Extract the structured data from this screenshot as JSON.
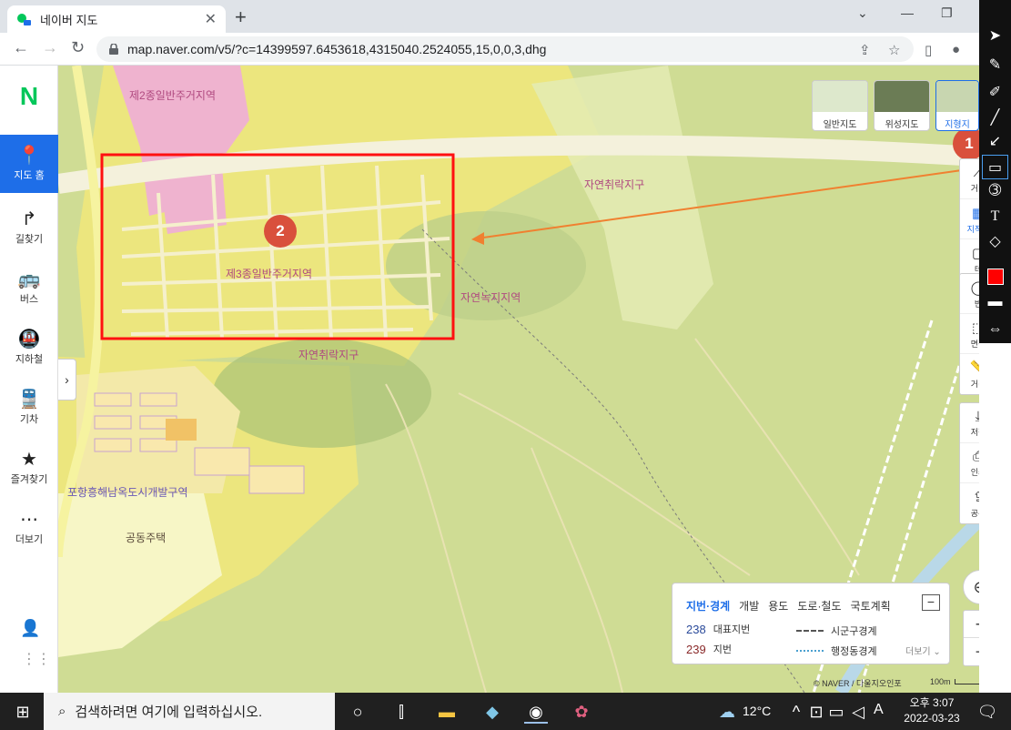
{
  "browser": {
    "tab_title": "네이버 지도",
    "url": "map.naver.com/v5/?c=14399597.6453618,4315040.2524055,15,0,0,3,dhg"
  },
  "sidebar": {
    "logo": "N",
    "items": [
      {
        "label": "지도 홈",
        "icon": "map-pin-icon"
      },
      {
        "label": "길찾기",
        "icon": "turn-right-icon"
      },
      {
        "label": "버스",
        "icon": "bus-icon"
      },
      {
        "label": "지하철",
        "icon": "subway-icon"
      },
      {
        "label": "기차",
        "icon": "train-icon"
      },
      {
        "label": "즐겨찾기",
        "icon": "star-icon"
      },
      {
        "label": "더보기",
        "icon": "more-icon"
      }
    ]
  },
  "map": {
    "labels": {
      "zone2": "제2종일반주거지역",
      "zone3": "제3종일반주거지역",
      "nature_village_1": "자연취락지구",
      "nature_village_2": "자연취락지구",
      "green": "자연녹지지역",
      "development": "포항흥해남옥도시개발구역",
      "housing": "공동주택"
    },
    "types": [
      "일반지도",
      "위성지도",
      "지형지"
    ],
    "annotations": {
      "badge1": "1",
      "badge2": "2"
    },
    "copyright": "© NAVER / 다울지오인포",
    "scale": "100m"
  },
  "right_controls": {
    "top_group": [
      "거리",
      "지적편",
      "테"
    ],
    "mid_group": [
      "반",
      "면적",
      "거리"
    ],
    "bottom_group": [
      "저장",
      "인쇄",
      "공유"
    ]
  },
  "legend": {
    "tabs": [
      "지번·경계",
      "개발",
      "용도",
      "도로·철도",
      "국토계획"
    ],
    "rows": [
      {
        "num": "238",
        "label": "대표지번",
        "line_label": "시군구경계"
      },
      {
        "num": "239",
        "label": "지번",
        "line_label": "행정동경계"
      }
    ],
    "more": "더보기",
    "minimize": "−"
  },
  "zoom": {
    "plus": "+",
    "minus": "−"
  },
  "taskbar": {
    "search_placeholder": "검색하려면 여기에 입력하십시오.",
    "weather": "12°C",
    "ime": "A",
    "time": "오후 3:07",
    "date": "2022-03-23"
  },
  "colors": {
    "accent": "#1e6ee8",
    "naver_green": "#03c75a",
    "highlight_box": "#ff0000",
    "badge": "#d9503c",
    "arrow": "#f08030"
  }
}
